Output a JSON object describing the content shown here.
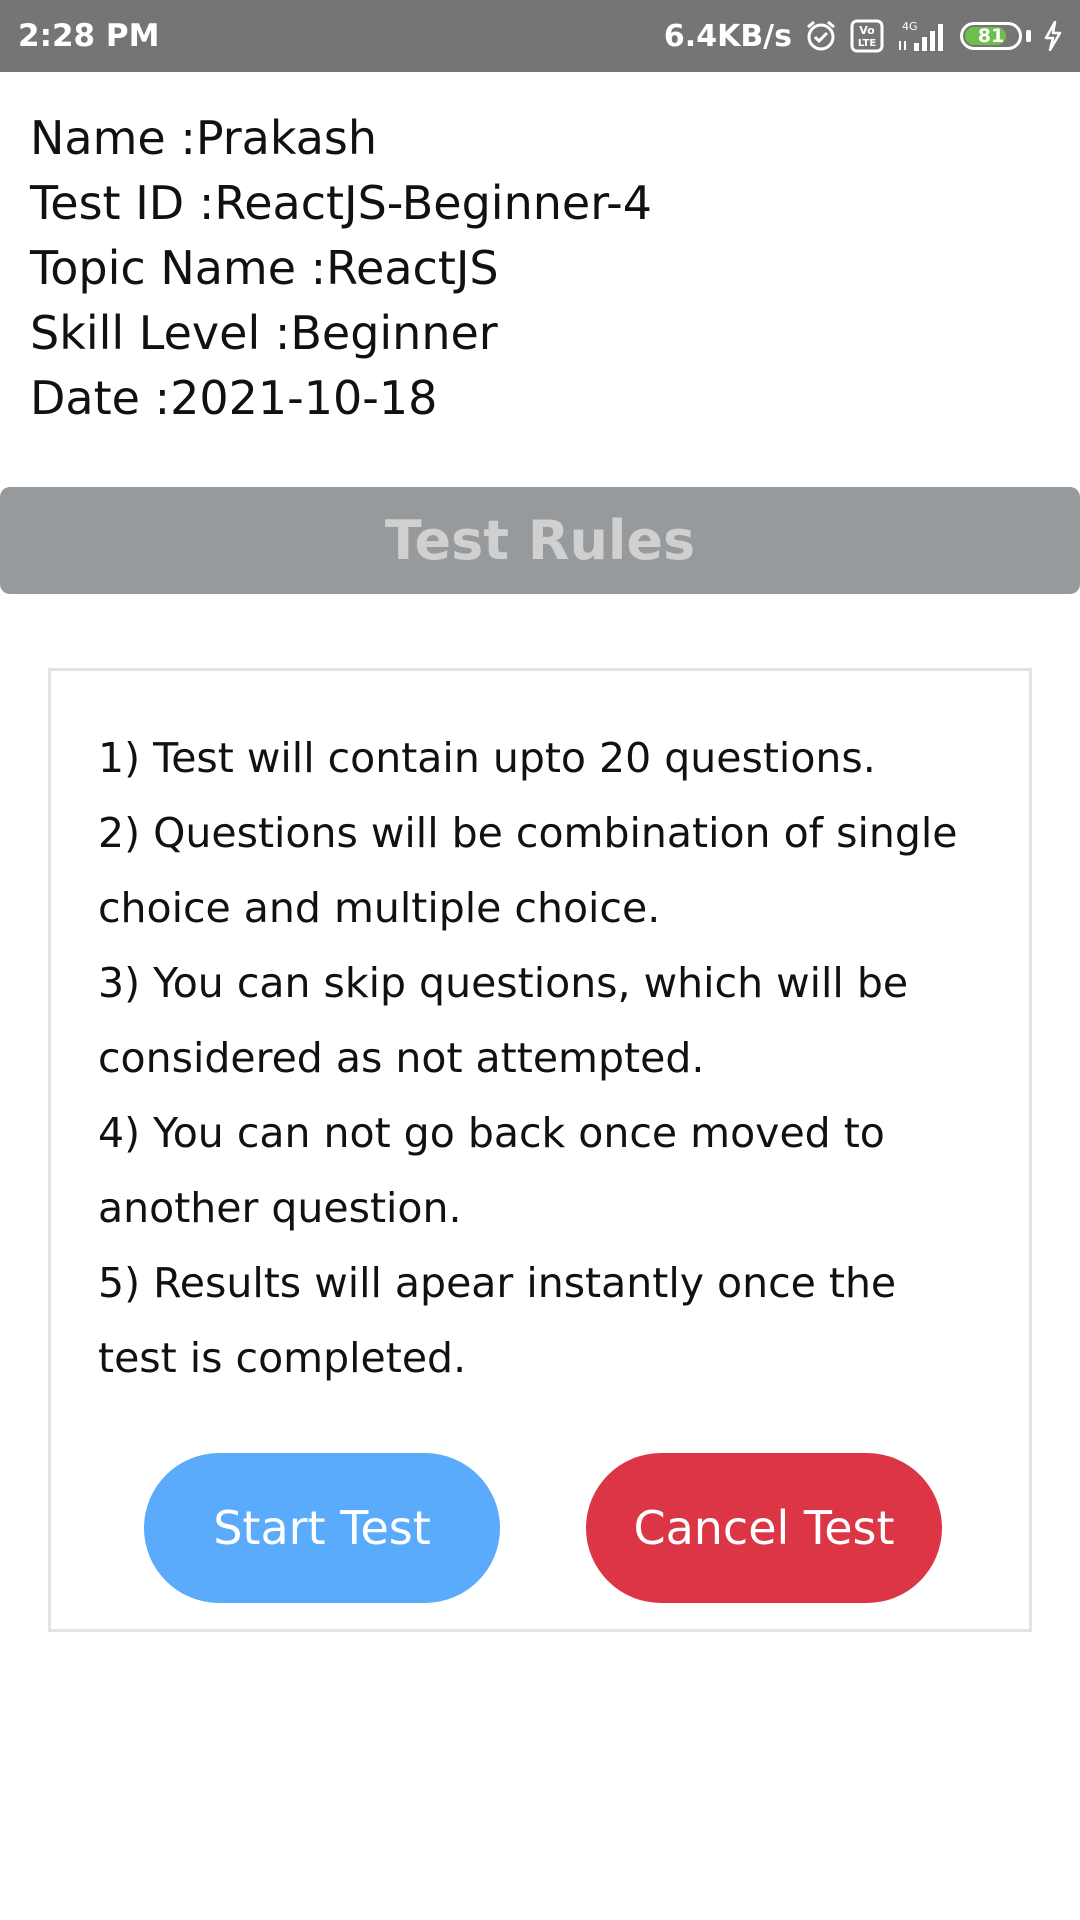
{
  "status_bar": {
    "time": "2:28 PM",
    "net_speed": "6.4KB/s",
    "battery_level": "81",
    "icons": [
      "alarm-icon",
      "volte-icon",
      "signal-4g-icon",
      "battery-icon",
      "charging-icon"
    ],
    "network_label": "4G",
    "volte_label": "Vo\nLTE"
  },
  "info": {
    "name": "Name :Prakash",
    "test_id": "Test ID :ReactJS-Beginner-4",
    "topic": "Topic Name :ReactJS",
    "skill": "Skill Level :Beginner",
    "date": "Date :2021-10-18"
  },
  "rules": {
    "header": "Test Rules",
    "items": [
      "1) Test will contain upto 20 questions.",
      "2) Questions will be combination of single choice and multiple choice.",
      "3) You can skip questions, which will be considered as not attempted.",
      "4) You can not go back once moved to another question.",
      "5) Results will apear instantly once the test is completed."
    ]
  },
  "buttons": {
    "start": "Start Test",
    "cancel": "Cancel Test"
  },
  "colors": {
    "status_bar": "#757575",
    "header_bg": "#979a9c",
    "start_button": "#5aabfb",
    "cancel_button": "#dc3545",
    "battery_fill": "#6cc04a"
  }
}
